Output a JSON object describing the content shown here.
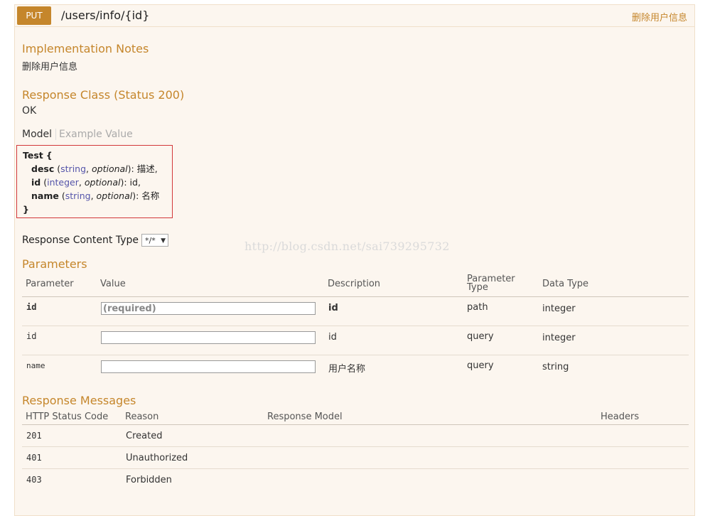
{
  "operation": {
    "method": "PUT",
    "path": "/users/info/{id}",
    "summary": "删除用户信息"
  },
  "implementation": {
    "title": "Implementation Notes",
    "notes": "删除用户信息"
  },
  "response_class": {
    "title": "Response Class (Status 200)",
    "value": "OK"
  },
  "model_tabs": {
    "model": "Model",
    "example": "Example Value"
  },
  "model": {
    "name": "Test",
    "open": "{",
    "close": "}",
    "props": [
      {
        "name": "desc",
        "type": "string",
        "optional": "optional",
        "desc": "描述"
      },
      {
        "name": "id",
        "type": "integer",
        "optional": "optional",
        "desc": "id"
      },
      {
        "name": "name",
        "type": "string",
        "optional": "optional",
        "desc": "名称"
      }
    ]
  },
  "content_type": {
    "label": "Response Content Type",
    "value": "*/*"
  },
  "watermark": "http://blog.csdn.net/sai739295732",
  "parameters": {
    "title": "Parameters",
    "headers": {
      "parameter": "Parameter",
      "value": "Value",
      "description": "Description",
      "param_type_1": "Parameter",
      "param_type_2": "Type",
      "data_type": "Data Type"
    },
    "rows": [
      {
        "name": "id",
        "placeholder": "(required)",
        "description": "id",
        "param_type": "path",
        "data_type": "integer"
      },
      {
        "name": "id",
        "placeholder": "",
        "description": "id",
        "param_type": "query",
        "data_type": "integer"
      },
      {
        "name": "name",
        "placeholder": "",
        "description": "用户名称",
        "param_type": "query",
        "data_type": "string"
      }
    ]
  },
  "responses": {
    "title": "Response Messages",
    "headers": {
      "code": "HTTP Status Code",
      "reason": "Reason",
      "model": "Response Model",
      "headers": "Headers"
    },
    "rows": [
      {
        "code": "201",
        "reason": "Created"
      },
      {
        "code": "401",
        "reason": "Unauthorized"
      },
      {
        "code": "403",
        "reason": "Forbidden"
      }
    ]
  },
  "colors": {
    "accent": "#c5862b",
    "panel_bg": "#fcf6ef",
    "model_border": "#d2383a"
  }
}
